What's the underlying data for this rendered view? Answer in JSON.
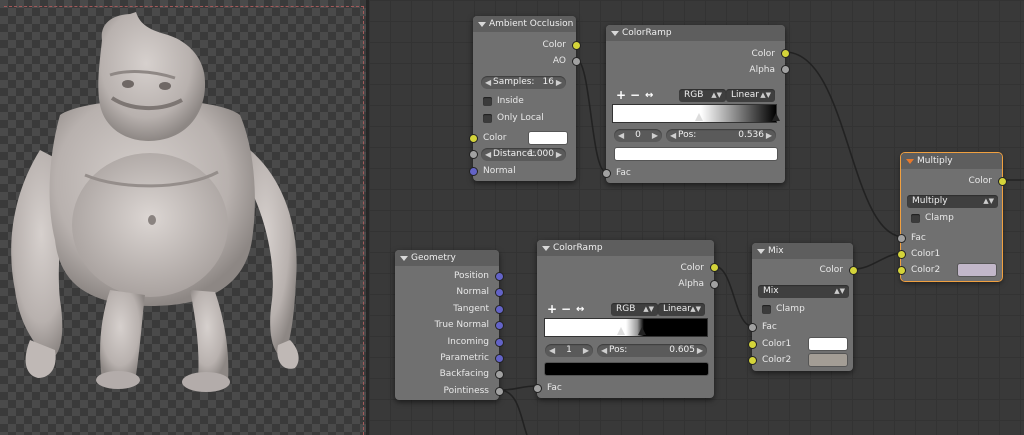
{
  "ao": {
    "title": "Ambient Occlusion",
    "out_color": "Color",
    "out_ao": "AO",
    "samples_label": "Samples:",
    "samples_value": "16",
    "inside_label": "Inside",
    "only_local_label": "Only Local",
    "color_label": "Color",
    "distance_label": "Distance:",
    "distance_value": "1.000",
    "normal_label": "Normal"
  },
  "ramp1": {
    "title": "ColorRamp",
    "out_color": "Color",
    "out_alpha": "Alpha",
    "add": "+",
    "remove": "−",
    "flip": "↔",
    "color_mode": "RGB",
    "interpolation": "Linear",
    "index": "0",
    "pos_label": "Pos:",
    "pos_value": "0.536",
    "fac_label": "Fac"
  },
  "multiply": {
    "title": "Multiply",
    "out_color": "Color",
    "blend_mode": "Multiply",
    "clamp_label": "Clamp",
    "fac_label": "Fac",
    "color1_label": "Color1",
    "color2_label": "Color2"
  },
  "geometry": {
    "title": "Geometry",
    "outputs": [
      "Position",
      "Normal",
      "Tangent",
      "True Normal",
      "Incoming",
      "Parametric",
      "Backfacing",
      "Pointiness"
    ]
  },
  "ramp2": {
    "title": "ColorRamp",
    "out_color": "Color",
    "out_alpha": "Alpha",
    "add": "+",
    "remove": "−",
    "flip": "↔",
    "color_mode": "RGB",
    "interpolation": "Linear",
    "index": "1",
    "pos_label": "Pos:",
    "pos_value": "0.605",
    "fac_label": "Fac"
  },
  "mix": {
    "title": "Mix",
    "out_color": "Color",
    "blend_mode": "Mix",
    "clamp_label": "Clamp",
    "fac_label": "Fac",
    "color1_label": "Color1",
    "color2_label": "Color2"
  },
  "colors": {
    "socket_color": "#d4d43a",
    "socket_float": "#a1a1a1",
    "socket_vector": "#6363c7",
    "node_body": "#707070",
    "node_header": "#5e5e5e",
    "selected_outline": "#f0a040",
    "ao_color_swatch": "#ffffff",
    "multiply_color2": "#c2b7c9",
    "mix_color1": "#ffffff",
    "mix_color2": "#a39d95",
    "sculpt_base": "#c4bdba"
  }
}
